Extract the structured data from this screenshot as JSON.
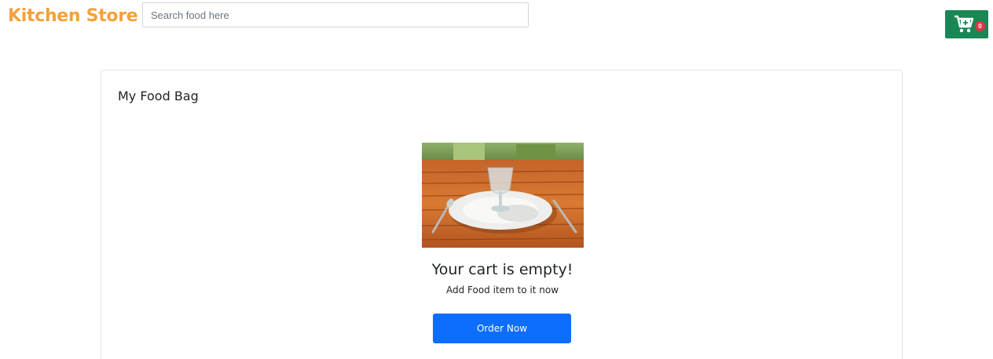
{
  "header": {
    "brand": "Kitchen Store",
    "search_placeholder": "Search food here",
    "search_value": "",
    "cart_icon": "cart-plus-icon",
    "cart_count": "0"
  },
  "bag": {
    "title": "My Food Bag",
    "empty_image": "empty-plate-photo",
    "empty_title": "Your cart is empty!",
    "empty_subtitle": "Add Food item to it now",
    "order_button": "Order Now"
  },
  "colors": {
    "brand": "#f4a13a",
    "cart_button": "#198754",
    "cart_badge": "#dc3545",
    "primary_button": "#0d6efd"
  }
}
